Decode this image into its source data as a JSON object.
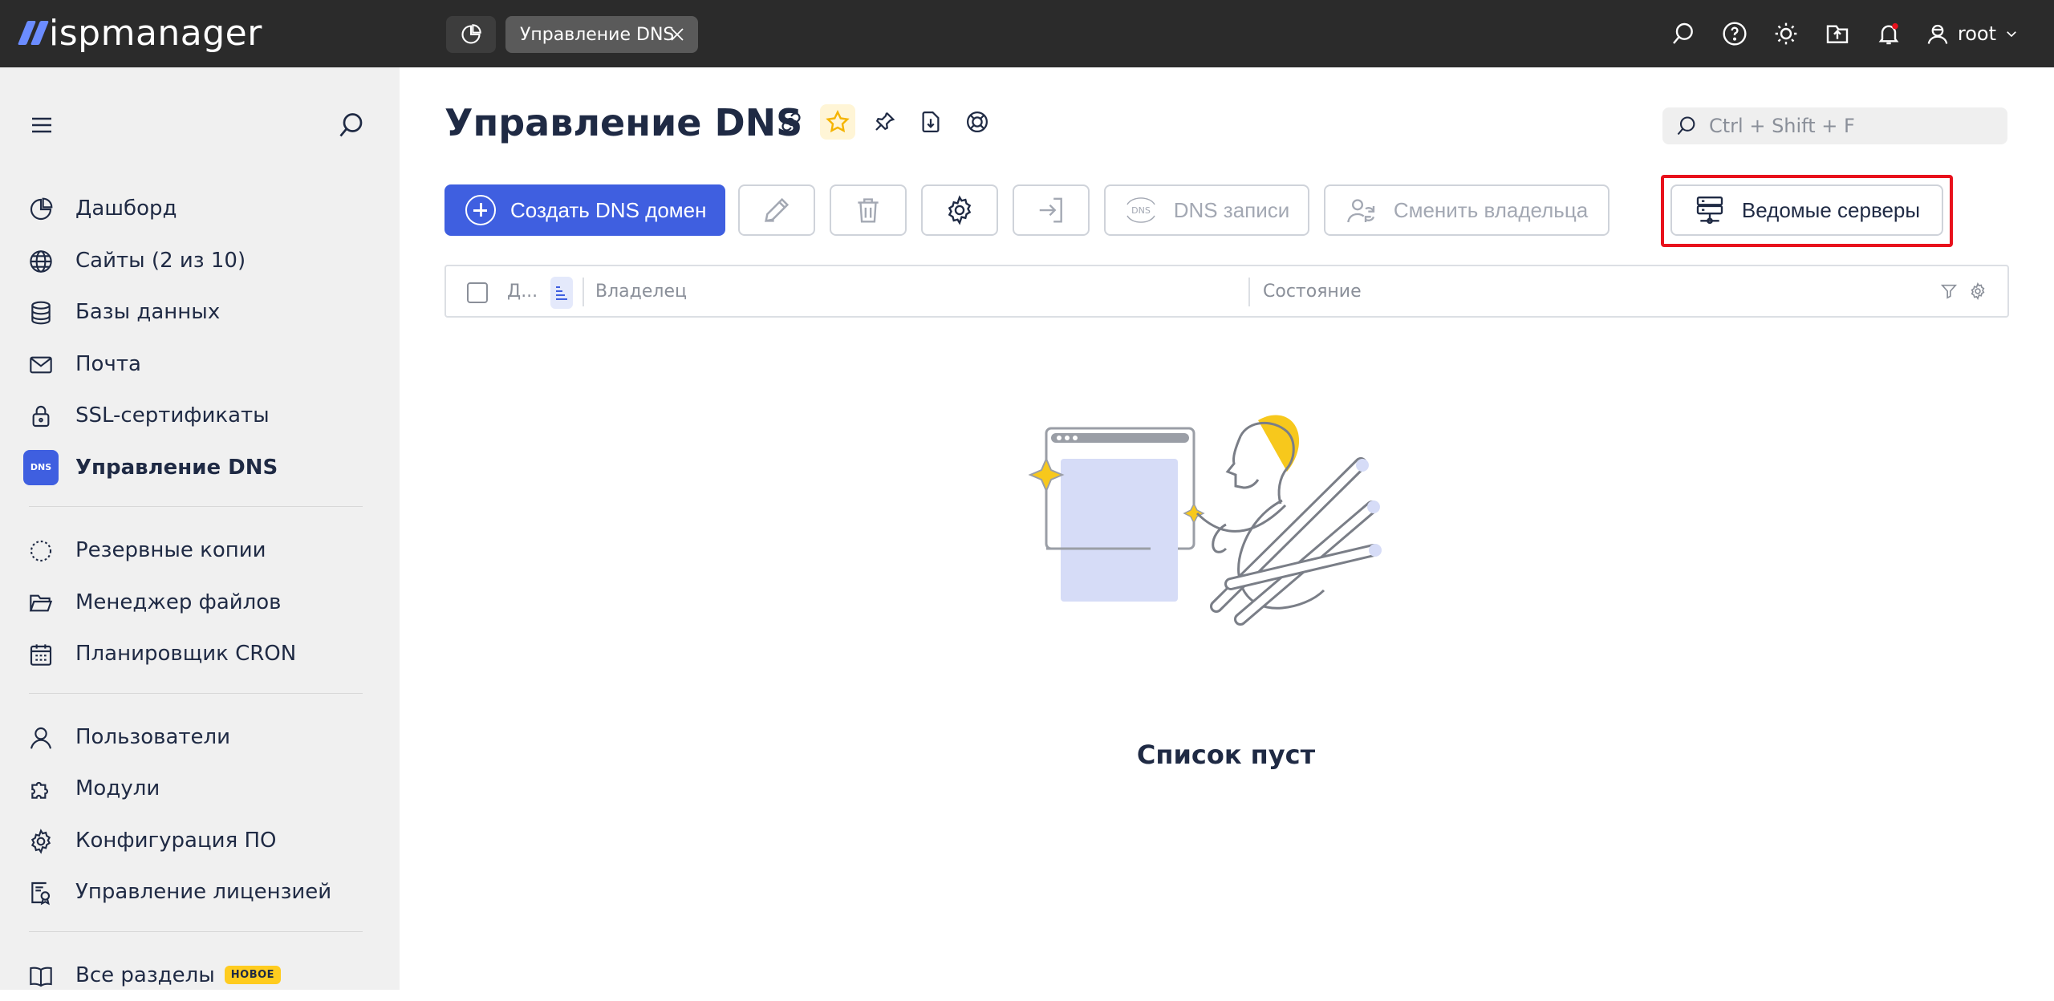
{
  "app": {
    "logo_text": "ispmanager",
    "accent": "#3f5fe0",
    "topbar_bg": "#2b2b2b"
  },
  "topbar": {
    "tabs": [
      {
        "label": "",
        "icon": "dashboard-icon"
      },
      {
        "label": "Управление DNS",
        "icon": "close-icon"
      }
    ],
    "icons": [
      "search-icon",
      "help-icon",
      "theme-icon",
      "upload-icon",
      "notification-icon"
    ],
    "user": "root"
  },
  "sidebar": {
    "items": [
      {
        "label": "Дашборд",
        "icon": "dashboard-icon"
      },
      {
        "label": "Сайты (2 из 10)",
        "icon": "globe-icon"
      },
      {
        "label": "Базы данных",
        "icon": "database-icon"
      },
      {
        "label": "Почта",
        "icon": "mail-icon"
      },
      {
        "label": "SSL-сертификаты",
        "icon": "lock-icon"
      },
      {
        "label": "Управление DNS",
        "icon": "dns-icon",
        "icon_text": "DNS"
      },
      {
        "label": "Резервные копии",
        "icon": "backup-icon"
      },
      {
        "label": "Менеджер файлов",
        "icon": "folder-icon"
      },
      {
        "label": "Планировщик CRON",
        "icon": "calendar-icon"
      },
      {
        "label": "Пользователи",
        "icon": "user-icon"
      },
      {
        "label": "Модули",
        "icon": "puzzle-icon"
      },
      {
        "label": "Конфигурация ПО",
        "icon": "gear-icon"
      },
      {
        "label": "Управление лицензией",
        "icon": "license-icon"
      },
      {
        "label": "Все разделы",
        "icon": "book-icon",
        "badge": "НОВОЕ"
      }
    ]
  },
  "main": {
    "title": "Управление DNS",
    "title_icons": [
      "link-icon",
      "star-icon",
      "pin-icon",
      "download-icon",
      "support-icon"
    ],
    "search_placeholder": "Ctrl + Shift + F",
    "toolbar": {
      "create": "Создать DNS домен",
      "dns_records": "DNS записи",
      "change_owner": "Сменить владельца",
      "slave_servers": "Ведомые серверы"
    },
    "table": {
      "columns": [
        "Д...",
        "Владелец",
        "Состояние"
      ]
    },
    "empty_text": "Список пуст"
  }
}
